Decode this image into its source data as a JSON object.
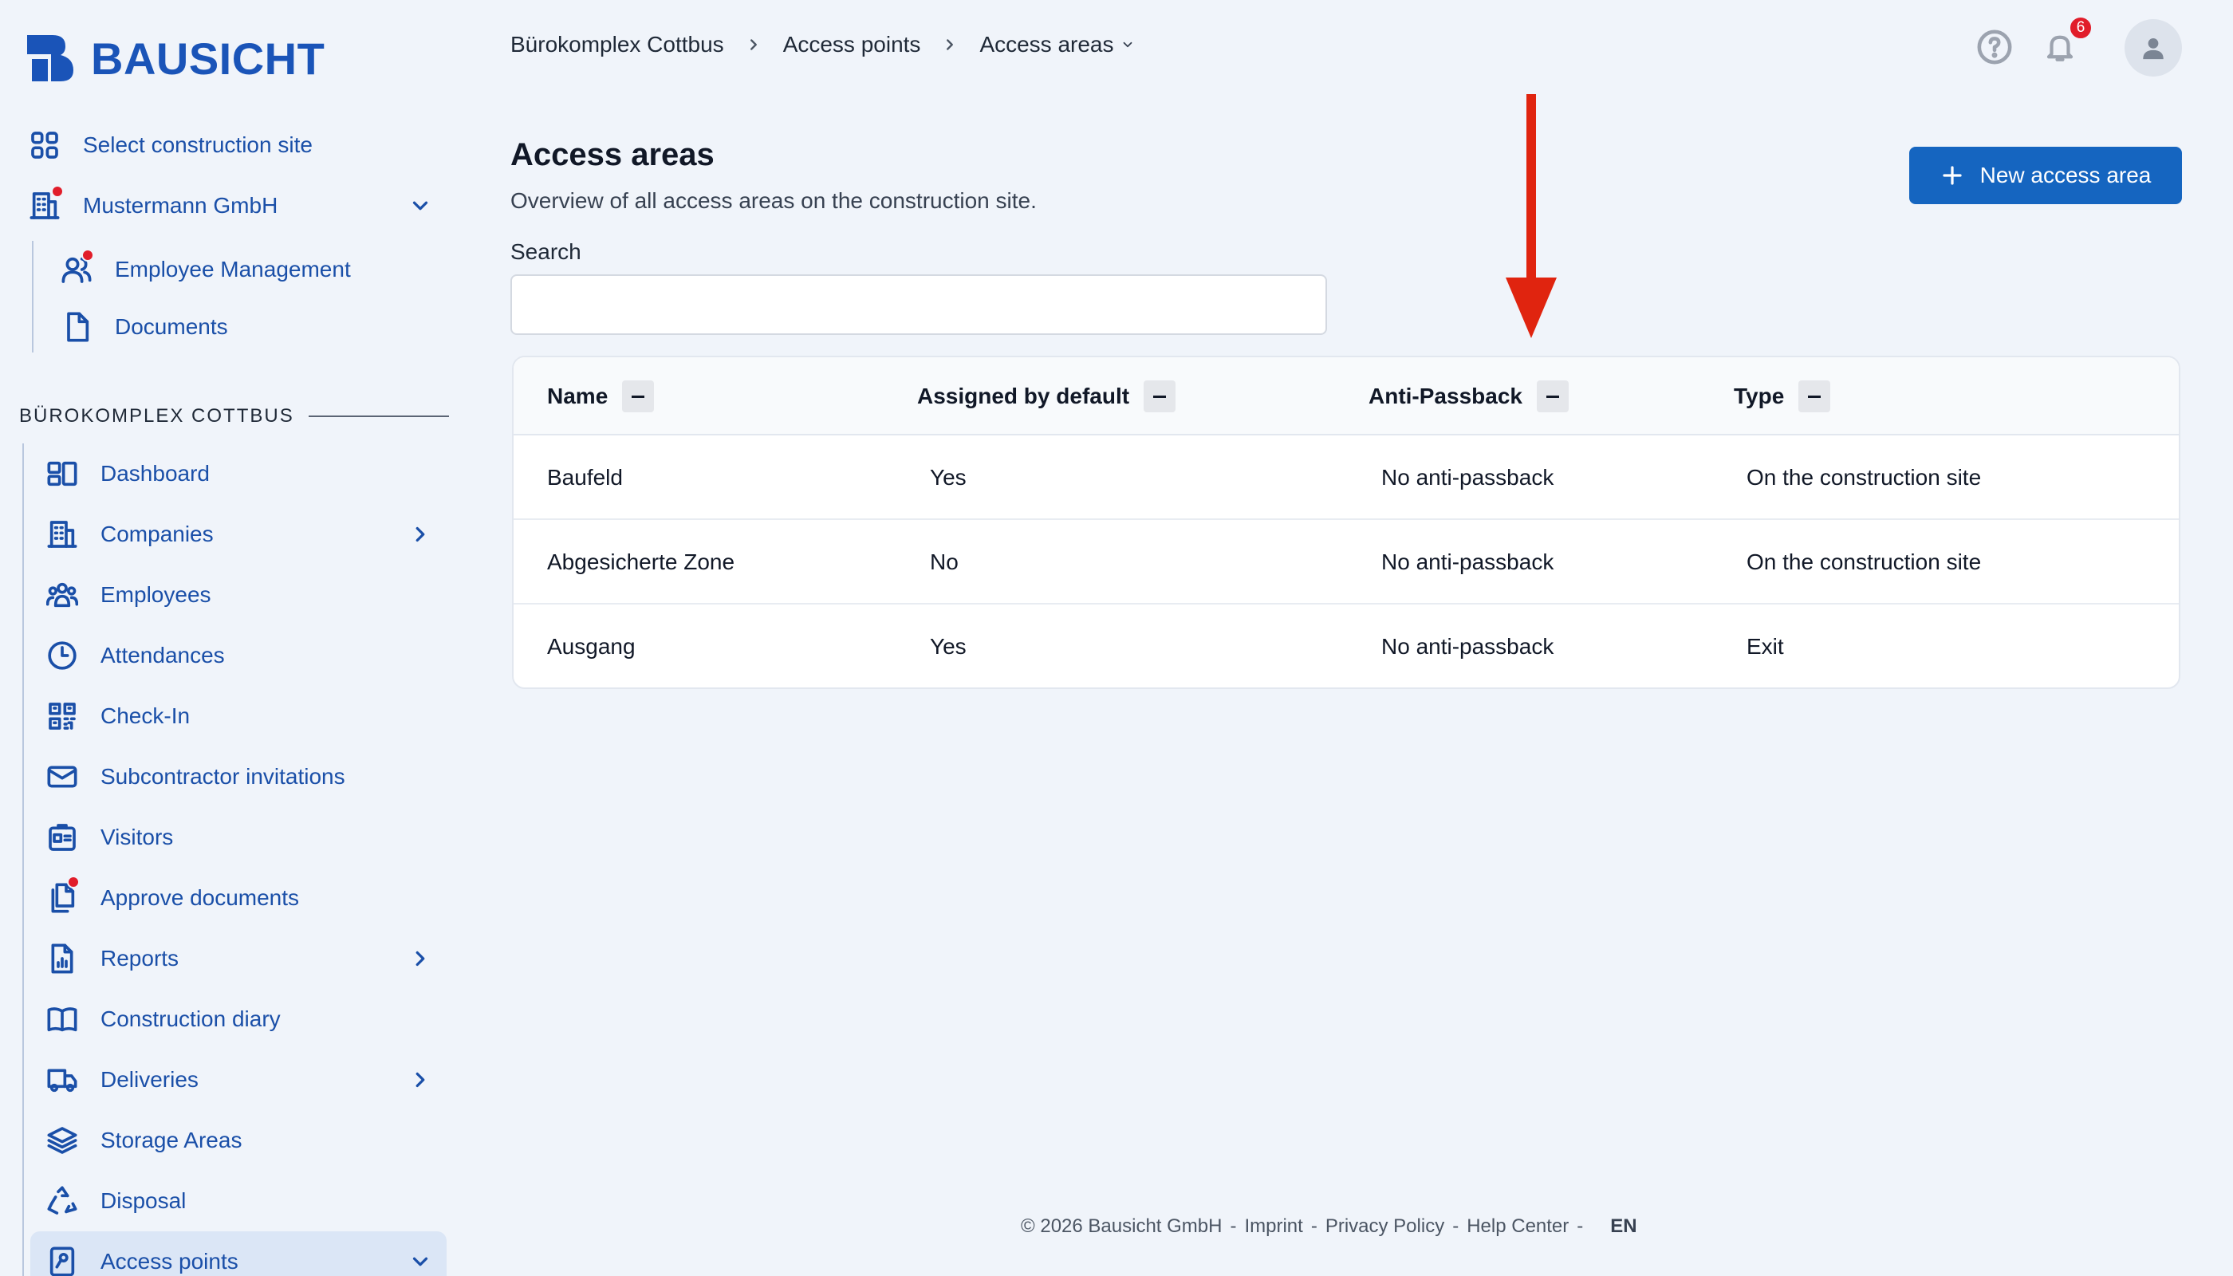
{
  "brand": {
    "name": "BAUSICHT",
    "color": "#1a54b8"
  },
  "sidebar": {
    "top_items": [
      {
        "label": "Select construction site",
        "icon": "grid-icon"
      },
      {
        "label": "Mustermann GmbH",
        "icon": "building-icon"
      }
    ],
    "company_sub_items": [
      {
        "label": "Employee Management",
        "icon": "users-icon"
      },
      {
        "label": "Documents",
        "icon": "document-icon"
      }
    ],
    "section_title": "BÜROKOMPLEX COTTBUS",
    "items": [
      {
        "label": "Dashboard",
        "icon": "dashboard-icon"
      },
      {
        "label": "Companies",
        "icon": "building-icon"
      },
      {
        "label": "Employees",
        "icon": "employees-icon"
      },
      {
        "label": "Attendances",
        "icon": "clock-icon"
      },
      {
        "label": "Check-In",
        "icon": "qr-code-icon"
      },
      {
        "label": "Subcontractor invitations",
        "icon": "mail-icon"
      },
      {
        "label": "Visitors",
        "icon": "id-badge-icon"
      },
      {
        "label": "Approve documents",
        "icon": "documents-icon"
      },
      {
        "label": "Reports",
        "icon": "report-icon"
      },
      {
        "label": "Construction diary",
        "icon": "book-icon"
      },
      {
        "label": "Deliveries",
        "icon": "truck-icon"
      },
      {
        "label": "Storage Areas",
        "icon": "layers-icon"
      },
      {
        "label": "Disposal",
        "icon": "recycle-icon"
      },
      {
        "label": "Access points",
        "icon": "key-card-icon"
      }
    ]
  },
  "breadcrumb": [
    "Bürokomplex Cottbus",
    "Access points",
    "Access areas"
  ],
  "header": {
    "notification_count": "6"
  },
  "main": {
    "title": "Access areas",
    "subtitle": "Overview of all access areas on the construction site.",
    "new_button": "New access area",
    "search": {
      "label": "Search",
      "value": "",
      "placeholder": ""
    }
  },
  "table": {
    "columns": [
      "Name",
      "Assigned by default",
      "Anti-Passback",
      "Type"
    ],
    "rows": [
      [
        "Baufeld",
        "Yes",
        "No anti-passback",
        "On the construction site"
      ],
      [
        "Abgesicherte Zone",
        "No",
        "No anti-passback",
        "On the construction site"
      ],
      [
        "Ausgang",
        "Yes",
        "No anti-passback",
        "Exit"
      ]
    ]
  },
  "footer": {
    "copyright": "© 2026 Bausicht GmbH",
    "links": [
      "Imprint",
      "Privacy Policy",
      "Help Center"
    ],
    "language": "EN"
  },
  "colors": {
    "accent": "#1565c0",
    "nav_text": "#1a4fa8",
    "notification": "#e11d2a",
    "annotation_arrow": "#e0240f"
  }
}
